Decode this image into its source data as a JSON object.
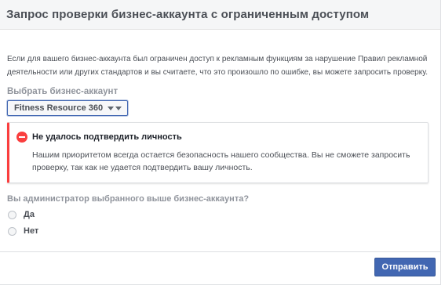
{
  "header": {
    "title": "Запрос проверки бизнес-аккаунта с ограниченным доступом"
  },
  "intro": {
    "text": "Если для вашего бизнес-аккаунта был ограничен доступ к рекламным функциям за нарушение Правил рекламной деятельности или других стандартов и вы считаете, что это произошло по ошибке, вы можете запросить проверку."
  },
  "account_select": {
    "label": "Выбрать бизнес-аккаунт",
    "selected_value": "Fitness Resource 360"
  },
  "error": {
    "title": "Не удалось подтвердить личность",
    "text": "Нашим приоритетом всегда остается безопасность нашего сообщества. Вы не сможете запросить проверку, так как не удается подтвердить вашу личность.",
    "color": "#fa3e3e"
  },
  "admin_question": {
    "label": "Вы администратор выбранного выше бизнес-аккаунта?",
    "options": [
      {
        "label": "Да",
        "selected": false
      },
      {
        "label": "Нет",
        "selected": false
      }
    ]
  },
  "footer": {
    "submit_label": "Отправить",
    "submit_color": "#4267b2"
  }
}
